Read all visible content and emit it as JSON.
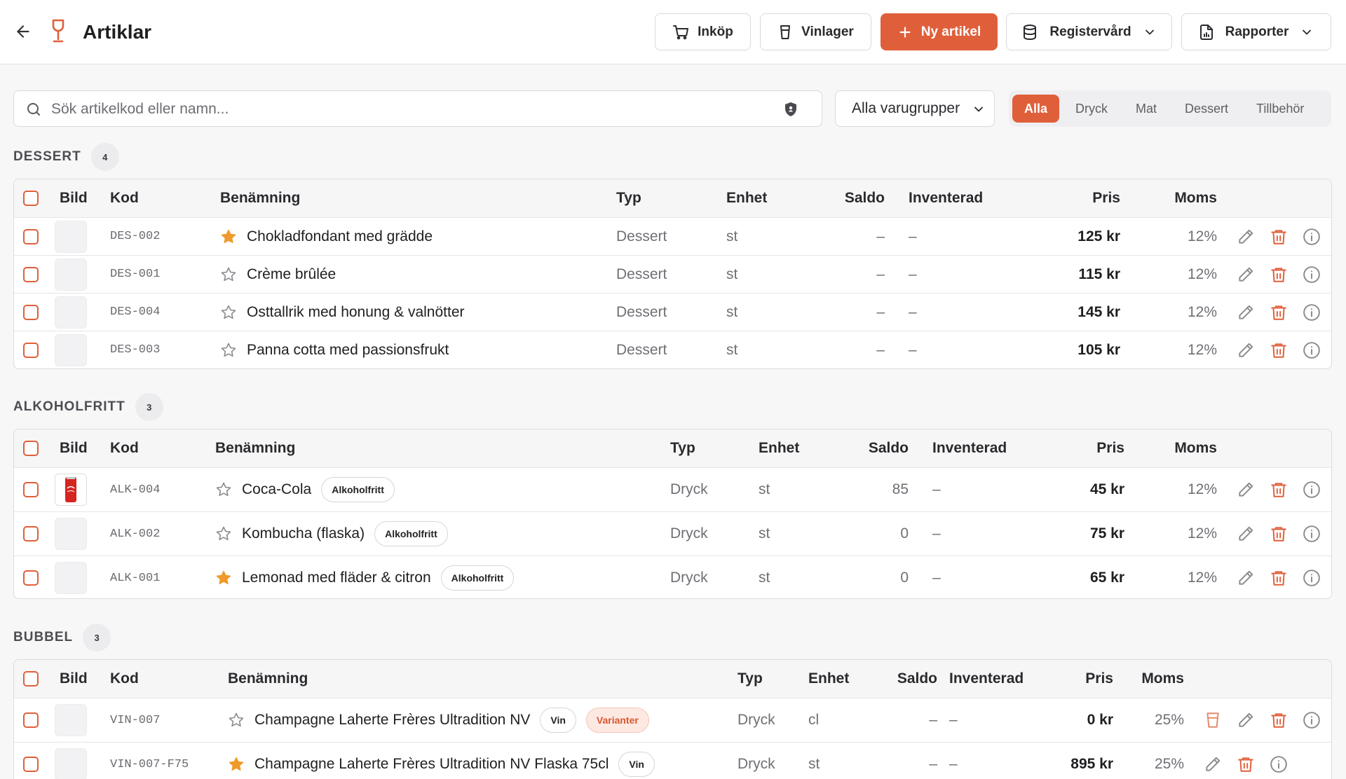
{
  "header": {
    "title": "Artiklar",
    "buttons": {
      "purchase": "Inköp",
      "wine_stock": "Vinlager",
      "new_item": "Ny artikel",
      "register": "Registervård",
      "reports": "Rapporter"
    }
  },
  "toolbar": {
    "search_placeholder": "Sök artikelkod eller namn...",
    "group_select": "Alla varugrupper",
    "filters": [
      "Alla",
      "Dryck",
      "Mat",
      "Dessert",
      "Tillbehör"
    ],
    "active_filter": "Alla"
  },
  "columns": {
    "image": "Bild",
    "code": "Kod",
    "name": "Benämning",
    "type": "Typ",
    "unit": "Enhet",
    "balance": "Saldo",
    "counted": "Inventerad",
    "price": "Pris",
    "vat": "Moms"
  },
  "sections": {
    "dessert": {
      "label": "DESSERT",
      "count": "4",
      "rows": [
        {
          "code": "DES-002",
          "name": "Chokladfondant med grädde",
          "starred": true,
          "type": "Dessert",
          "unit": "st",
          "balance": "–",
          "counted": "–",
          "price": "125 kr",
          "vat": "12%"
        },
        {
          "code": "DES-001",
          "name": "Crème brûlée",
          "starred": false,
          "type": "Dessert",
          "unit": "st",
          "balance": "–",
          "counted": "–",
          "price": "115 kr",
          "vat": "12%"
        },
        {
          "code": "DES-004",
          "name": "Osttallrik med honung & valnötter",
          "starred": false,
          "type": "Dessert",
          "unit": "st",
          "balance": "–",
          "counted": "–",
          "price": "145 kr",
          "vat": "12%"
        },
        {
          "code": "DES-003",
          "name": "Panna cotta med passionsfrukt",
          "starred": false,
          "type": "Dessert",
          "unit": "st",
          "balance": "–",
          "counted": "–",
          "price": "105 kr",
          "vat": "12%"
        }
      ]
    },
    "alkoholfritt": {
      "label": "ALKOHOLFRITT",
      "count": "3",
      "rows": [
        {
          "code": "ALK-004",
          "name": "Coca-Cola",
          "tag": "Alkoholfritt",
          "starred": false,
          "type": "Dryck",
          "unit": "st",
          "balance": "85",
          "counted": "–",
          "price": "45 kr",
          "vat": "12%",
          "image": "coca-cola-can"
        },
        {
          "code": "ALK-002",
          "name": "Kombucha (flaska)",
          "tag": "Alkoholfritt",
          "starred": false,
          "type": "Dryck",
          "unit": "st",
          "balance": "0",
          "counted": "–",
          "price": "75 kr",
          "vat": "12%"
        },
        {
          "code": "ALK-001",
          "name": "Lemonad med fläder & citron",
          "tag": "Alkoholfritt",
          "starred": true,
          "type": "Dryck",
          "unit": "st",
          "balance": "0",
          "counted": "–",
          "price": "65 kr",
          "vat": "12%"
        }
      ]
    },
    "bubbel": {
      "label": "BUBBEL",
      "count": "3",
      "rows": [
        {
          "code": "VIN-007",
          "name": "Champagne Laherte Frères Ultradition NV",
          "tag": "Vin",
          "tag2": "Varianter",
          "starred": false,
          "type": "Dryck",
          "unit": "cl",
          "balance": "–",
          "counted": "–",
          "price": "0 kr",
          "vat": "25%"
        },
        {
          "code": "VIN-007-F75",
          "name": "Champagne Laherte Frères Ultradition NV Flaska 75cl",
          "tag": "Vin",
          "starred": true,
          "type": "Dryck",
          "unit": "st",
          "balance": "–",
          "counted": "–",
          "price": "895 kr",
          "vat": "25%"
        }
      ]
    }
  },
  "colors": {
    "accent": "#e05f3b",
    "star": "#ef9a2b",
    "border": "#dcdce0"
  }
}
